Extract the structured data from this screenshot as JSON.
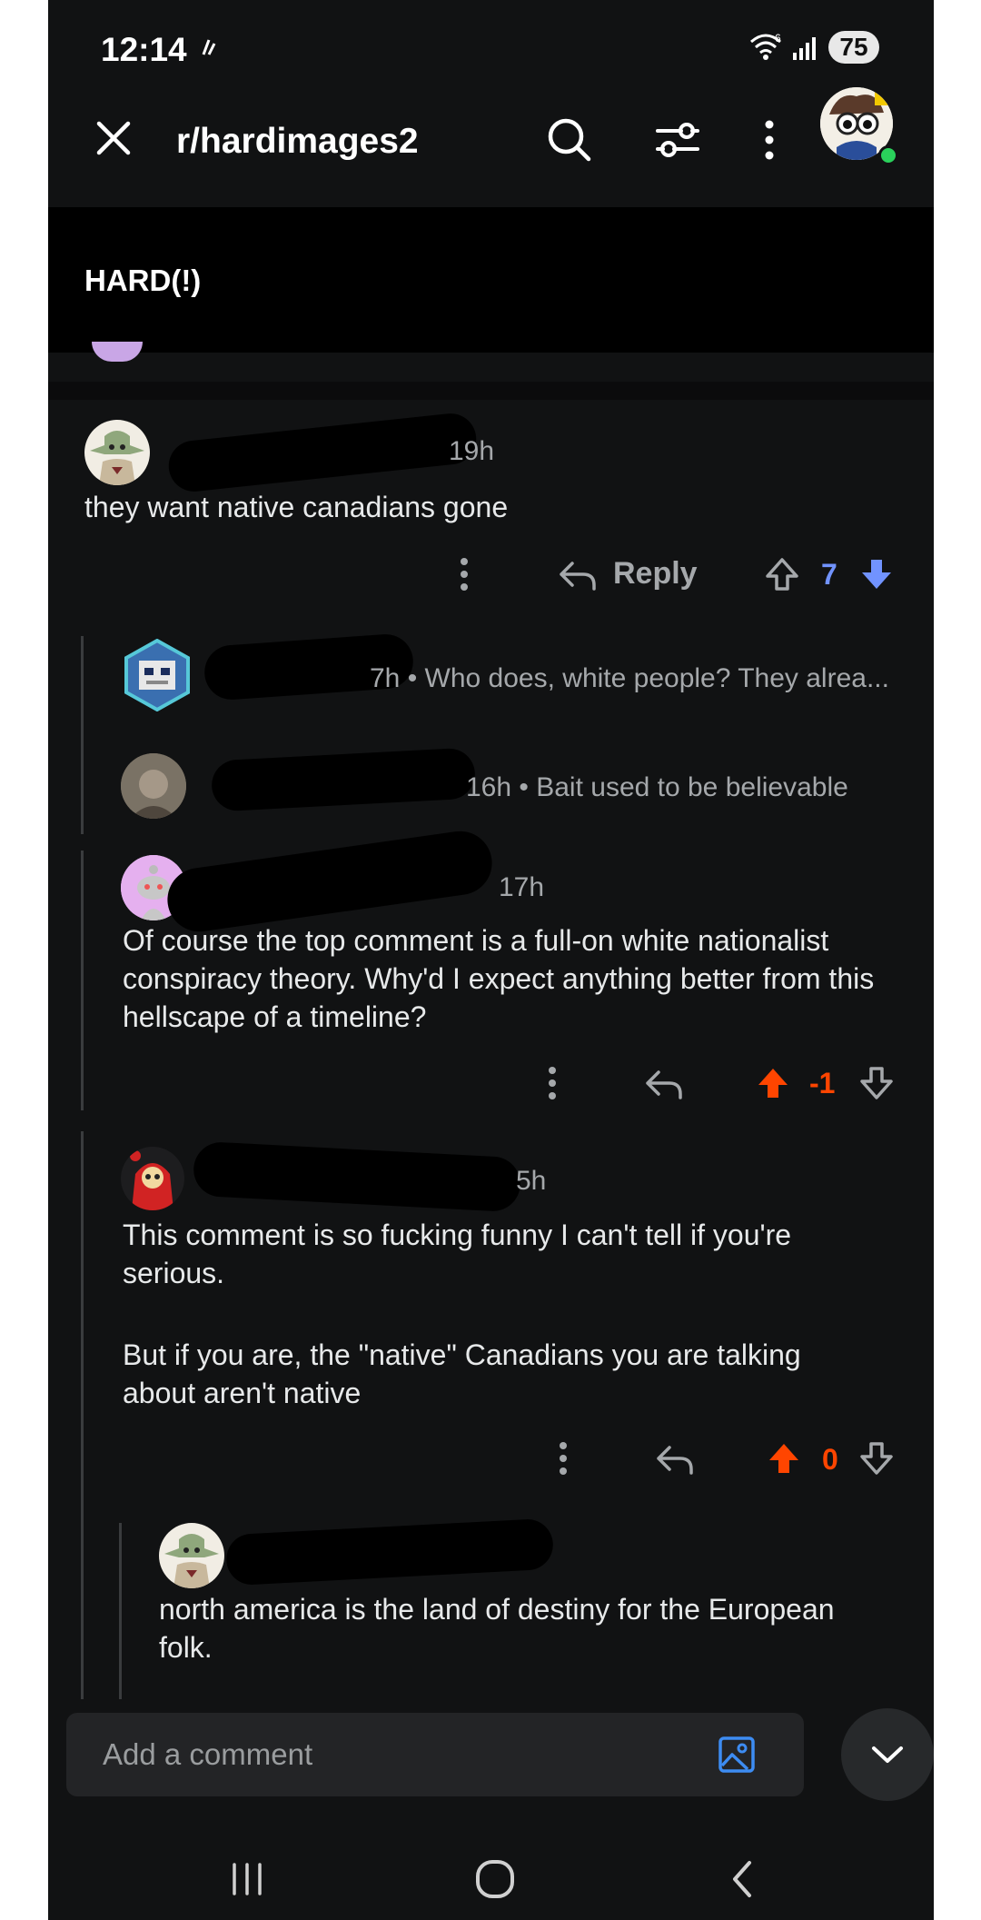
{
  "status_bar": {
    "time": "12:14",
    "battery": "75"
  },
  "header": {
    "subreddit": "r/hardimages2"
  },
  "post": {
    "flair_title": "HARD(!)"
  },
  "comments": [
    {
      "meta": "19h",
      "text": "they want native canadians gone",
      "reply_label": "Reply",
      "votes": "7"
    },
    {
      "meta": "7h • Who does, white people? They alrea...",
      "collapsed": true
    },
    {
      "meta": "16h • Bait used to be believable",
      "collapsed": true
    },
    {
      "meta": "17h",
      "text": "Of course the top comment is a full-on white nationalist conspiracy theory. Why'd I expect anything better from this hellscape of a timeline?",
      "votes": "-1"
    },
    {
      "meta": "5h",
      "text_p1": "This comment is so fucking funny I can't tell if you're serious.",
      "text_p2": "But if you are, the \"native\" Canadians you are talking about aren't native",
      "votes": "0"
    },
    {
      "meta": "",
      "text": "north america is the land of destiny for the European folk."
    }
  ],
  "composer": {
    "placeholder": "Add a comment"
  },
  "colors": {
    "upvote_active": "#ff4500",
    "downvote_active": "#7193ff",
    "background": "#111213"
  }
}
